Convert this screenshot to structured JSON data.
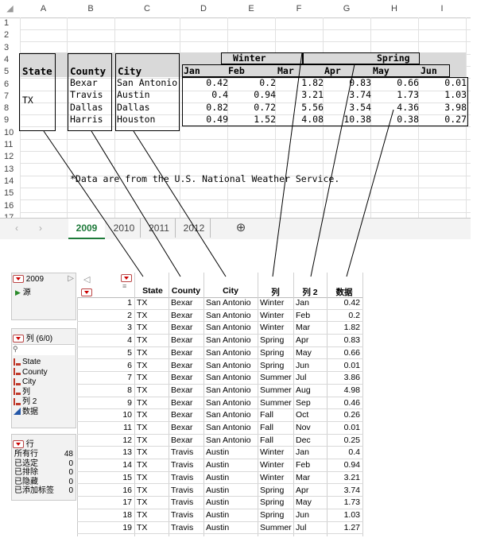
{
  "spreadsheet": {
    "columns": [
      "A",
      "B",
      "C",
      "D",
      "E",
      "F",
      "G",
      "H",
      "I"
    ],
    "rows": [
      "1",
      "2",
      "3",
      "4",
      "5",
      "6",
      "7",
      "8",
      "9",
      "10",
      "11",
      "12",
      "13",
      "14",
      "15",
      "16",
      "17"
    ],
    "seasons": [
      "Winter",
      "Spring"
    ],
    "headers": {
      "state": "State",
      "county": "County",
      "city": "City"
    },
    "months": [
      "Jan",
      "Feb",
      "Mar",
      "Apr",
      "May",
      "Jun"
    ],
    "state_value": "TX",
    "data_rows": [
      {
        "county": "Bexar",
        "city": "San Antonio",
        "values": [
          "0.42",
          "0.2",
          "1.82",
          "0.83",
          "0.66",
          "0.01"
        ]
      },
      {
        "county": "Travis",
        "city": "Austin",
        "values": [
          "0.4",
          "0.94",
          "3.21",
          "3.74",
          "1.73",
          "1.03"
        ]
      },
      {
        "county": "Dallas",
        "city": "Dallas",
        "values": [
          "0.82",
          "0.72",
          "5.56",
          "3.54",
          "4.36",
          "3.98"
        ]
      },
      {
        "county": "Harris",
        "city": "Houston",
        "values": [
          "0.49",
          "1.52",
          "4.08",
          "10.38",
          "0.38",
          "0.27"
        ]
      }
    ],
    "note": "*Data are from the U.S. National Weather Service.",
    "sheet_tabs": [
      "2009",
      "2010",
      "2011",
      "2012"
    ],
    "active_tab": "2009",
    "add_sheet_icon": "plus-circle-icon",
    "nav_left": "‹",
    "nav_right": "›"
  },
  "jmp": {
    "table_name": "2009",
    "source_label": "源",
    "columns_panel_title": "列 (6/0)",
    "search_icon": "search-icon",
    "column_list": [
      {
        "name": "State",
        "kind": "nominal"
      },
      {
        "name": "County",
        "kind": "nominal"
      },
      {
        "name": "City",
        "kind": "nominal"
      },
      {
        "name": "列",
        "kind": "nominal"
      },
      {
        "name": "列 2",
        "kind": "nominal"
      },
      {
        "name": "数据",
        "kind": "continuous"
      }
    ],
    "rows_panel_title": "行",
    "row_stats": [
      {
        "label": "所有行",
        "value": "48"
      },
      {
        "label": "已选定",
        "value": "0"
      },
      {
        "label": "已排除",
        "value": "0"
      },
      {
        "label": "已隐藏",
        "value": "0"
      },
      {
        "label": "已添加标签",
        "value": "0"
      }
    ],
    "headers": [
      "State",
      "County",
      "City",
      "列",
      "列 2",
      "数据"
    ],
    "rows": [
      [
        "1",
        "TX",
        "Bexar",
        "San Antonio",
        "Winter",
        "Jan",
        "0.42"
      ],
      [
        "2",
        "TX",
        "Bexar",
        "San Antonio",
        "Winter",
        "Feb",
        "0.2"
      ],
      [
        "3",
        "TX",
        "Bexar",
        "San Antonio",
        "Winter",
        "Mar",
        "1.82"
      ],
      [
        "4",
        "TX",
        "Bexar",
        "San Antonio",
        "Spring",
        "Apr",
        "0.83"
      ],
      [
        "5",
        "TX",
        "Bexar",
        "San Antonio",
        "Spring",
        "May",
        "0.66"
      ],
      [
        "6",
        "TX",
        "Bexar",
        "San Antonio",
        "Spring",
        "Jun",
        "0.01"
      ],
      [
        "7",
        "TX",
        "Bexar",
        "San Antonio",
        "Summer",
        "Jul",
        "3.86"
      ],
      [
        "8",
        "TX",
        "Bexar",
        "San Antonio",
        "Summer",
        "Aug",
        "4.98"
      ],
      [
        "9",
        "TX",
        "Bexar",
        "San Antonio",
        "Summer",
        "Sep",
        "0.46"
      ],
      [
        "10",
        "TX",
        "Bexar",
        "San Antonio",
        "Fall",
        "Oct",
        "0.26"
      ],
      [
        "11",
        "TX",
        "Bexar",
        "San Antonio",
        "Fall",
        "Nov",
        "0.01"
      ],
      [
        "12",
        "TX",
        "Bexar",
        "San Antonio",
        "Fall",
        "Dec",
        "0.25"
      ],
      [
        "13",
        "TX",
        "Travis",
        "Austin",
        "Winter",
        "Jan",
        "0.4"
      ],
      [
        "14",
        "TX",
        "Travis",
        "Austin",
        "Winter",
        "Feb",
        "0.94"
      ],
      [
        "15",
        "TX",
        "Travis",
        "Austin",
        "Winter",
        "Mar",
        "3.21"
      ],
      [
        "16",
        "TX",
        "Travis",
        "Austin",
        "Spring",
        "Apr",
        "3.74"
      ],
      [
        "17",
        "TX",
        "Travis",
        "Austin",
        "Spring",
        "May",
        "1.73"
      ],
      [
        "18",
        "TX",
        "Travis",
        "Austin",
        "Spring",
        "Jun",
        "1.03"
      ],
      [
        "19",
        "TX",
        "Travis",
        "Austin",
        "Summer",
        "Jul",
        "1.27"
      ]
    ]
  }
}
